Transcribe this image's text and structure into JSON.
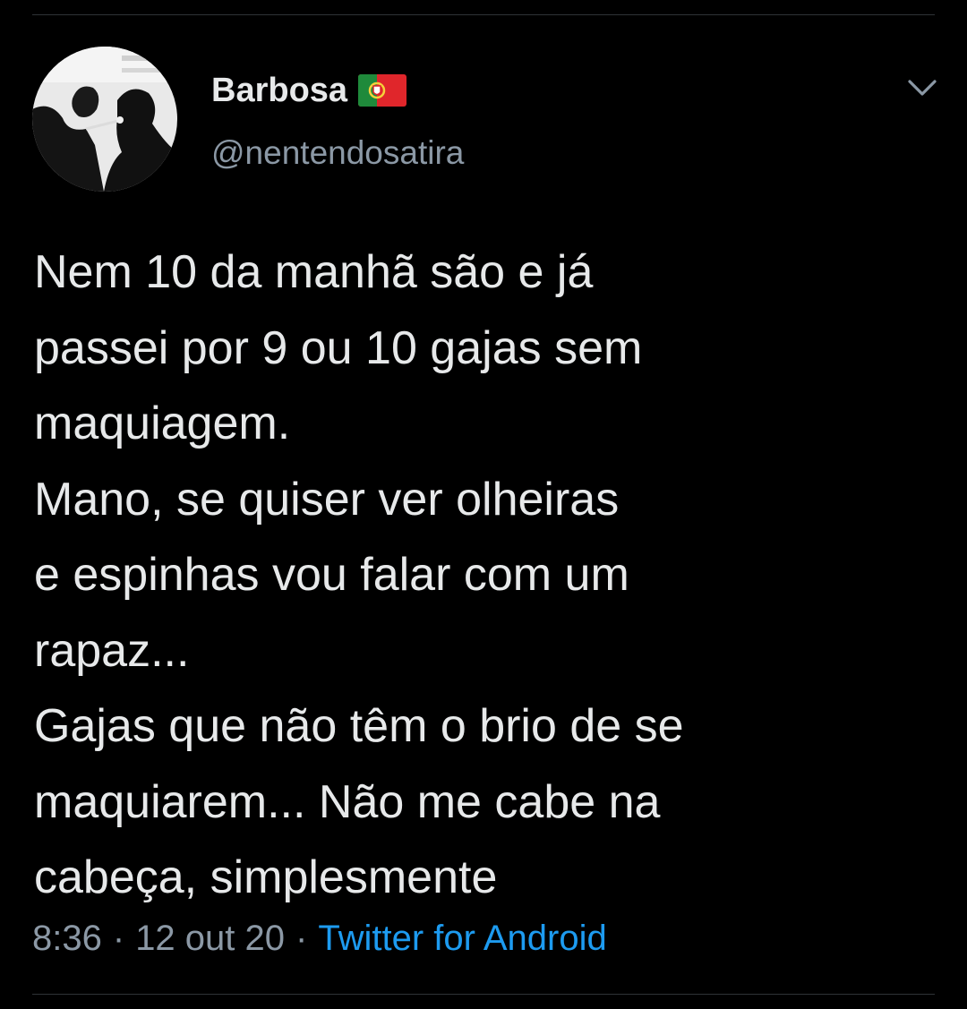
{
  "tweet": {
    "author": {
      "display_name": "Barbosa",
      "flag_icon": "portugal-flag-icon",
      "handle": "@nentendosatira"
    },
    "text_lines": [
      "Nem 10 da manhã são e já",
      "passei por 9 ou 10 gajas sem",
      "maquiagem.",
      "Mano, se quiser ver olheiras",
      "e espinhas vou falar com um",
      "rapaz...",
      "Gajas que não têm o brio de se",
      "maquiarem... Não me cabe na",
      "cabeça, simplesmente"
    ],
    "time": "8:36",
    "separator": "·",
    "date": "12 out 20",
    "source": "Twitter for Android"
  },
  "colors": {
    "background": "#000000",
    "text": "#e7e9ea",
    "secondary": "#8b98a5",
    "link": "#1d9bf0",
    "divider": "#2f3336"
  },
  "icons": {
    "menu": "chevron-down-icon"
  }
}
